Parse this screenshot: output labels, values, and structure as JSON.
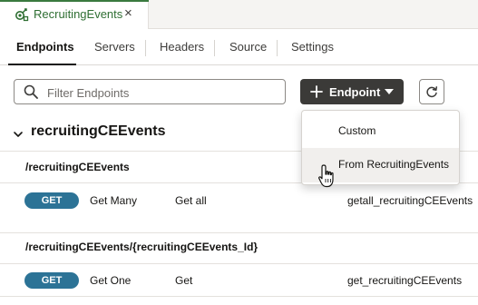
{
  "file_tab": {
    "title": "RecruitingEvents",
    "close_glyph": "×",
    "icon": "connection-icon",
    "accent_color": "#3a7a3f"
  },
  "tabs": [
    {
      "label": "Endpoints",
      "active": true
    },
    {
      "label": "Servers"
    },
    {
      "label": "Headers"
    },
    {
      "label": "Source"
    },
    {
      "label": "Settings"
    }
  ],
  "toolbar": {
    "search_placeholder": "Filter Endpoints",
    "add_label": "Endpoint",
    "add_button_color": "#3b3a38"
  },
  "group": {
    "title": "recruitingCEEvents"
  },
  "resources": [
    {
      "path": "/recruitingCEEvents",
      "endpoints": [
        {
          "method": "GET",
          "name": "Get Many",
          "description": "Get all",
          "operation_id": "getall_recruitingCEEvents"
        }
      ]
    },
    {
      "path": "/recruitingCEEvents/{recruitingCEEvents_Id}",
      "endpoints": [
        {
          "method": "GET",
          "name": "Get One",
          "description": "Get",
          "operation_id": "get_recruitingCEEvents"
        }
      ]
    }
  ],
  "method_color": "#2c7396",
  "endpoint_menu": {
    "items": [
      {
        "label": "Custom"
      },
      {
        "label": "From RecruitingEvents",
        "hovered": true
      }
    ]
  }
}
